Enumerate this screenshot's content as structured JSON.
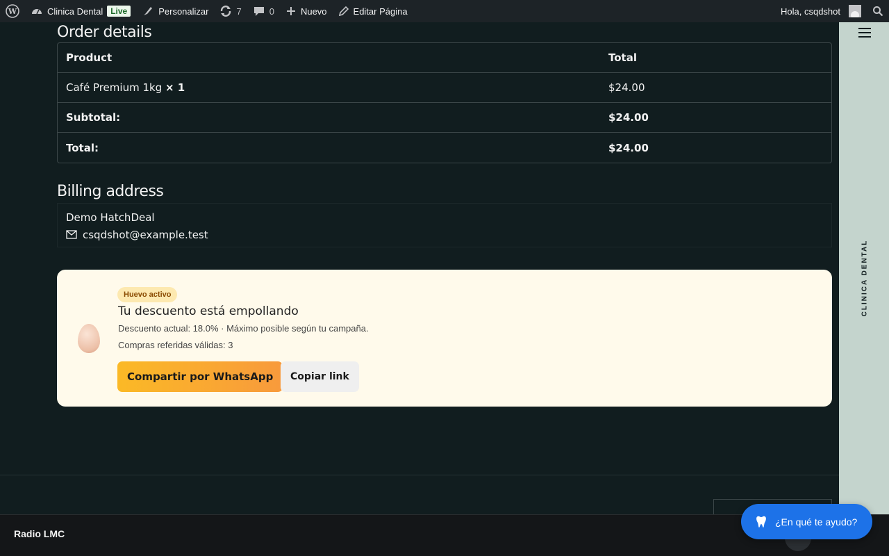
{
  "adminbar": {
    "site_name": "Clinica Dental",
    "live_badge": "Live",
    "customize": "Personalizar",
    "updates_count": "7",
    "comments_count": "0",
    "new_label": "Nuevo",
    "edit_page": "Editar Página",
    "greeting": "Hola, csqdshot"
  },
  "sidebar": {
    "vertical_label": "CLINICA DENTAL"
  },
  "order": {
    "title": "Order details",
    "headers": [
      "Product",
      "Total"
    ],
    "item_name": "Café Premium 1kg",
    "item_qty": "× 1",
    "item_total": "$24.00",
    "subtotal_label": "Subtotal:",
    "subtotal_value": "$24.00",
    "total_label": "Total:",
    "total_value": "$24.00"
  },
  "billing": {
    "title": "Billing address",
    "name": "Demo HatchDeal",
    "email": "csqdshot@example.test"
  },
  "promo": {
    "badge": "Huevo activo",
    "title": "Tu descuento está empollando",
    "line1": "Descuento actual: 18.0% · Máximo posible según tu campaña.",
    "line2": "Compras referidas válidas: 3",
    "whatsapp_button": "Compartir por WhatsApp",
    "copy_button": "Copiar link"
  },
  "radio": {
    "label": "Radio LMC"
  },
  "chat": {
    "label": "¿En qué te ayudo?"
  },
  "colors": {
    "background": "#111d1f",
    "adminbar": "#1d2327",
    "sidebar": "#c4d4cd",
    "promo_bg": "#fffaeb",
    "chat": "#1d72e8"
  },
  "icons": [
    "wordpress-icon",
    "dashboard-icon",
    "brush-icon",
    "updates-icon",
    "comment-icon",
    "plus-icon",
    "pencil-icon",
    "search-icon",
    "menu-icon",
    "mail-icon",
    "egg-icon",
    "tooth-icon"
  ]
}
